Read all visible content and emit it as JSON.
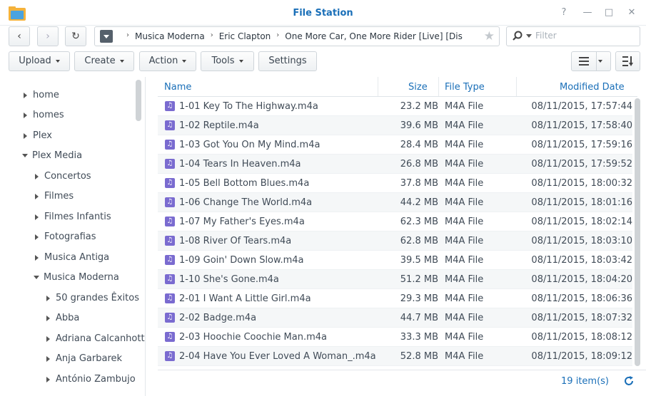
{
  "window": {
    "title": "File Station",
    "controls": {
      "help": "?",
      "minimize": "—",
      "maximize": "□",
      "close": "✕"
    }
  },
  "nav": {
    "back_icon": "‹",
    "forward_icon": "›",
    "refresh_icon": "↻"
  },
  "path": {
    "crumbs": [
      "Musica Moderna",
      "Eric Clapton",
      "One More Car, One More Rider [Live] [Dis"
    ],
    "separator": "›",
    "star_icon": "★"
  },
  "filter": {
    "placeholder": "Filter",
    "value": ""
  },
  "toolbar": {
    "upload": "Upload",
    "create": "Create",
    "action": "Action",
    "tools": "Tools",
    "settings": "Settings"
  },
  "tree": {
    "items": [
      {
        "label": "home",
        "state": "closed",
        "level": 0
      },
      {
        "label": "homes",
        "state": "closed",
        "level": 0
      },
      {
        "label": "Plex",
        "state": "closed",
        "level": 0
      },
      {
        "label": "Plex Media",
        "state": "open",
        "level": 0
      },
      {
        "label": "Concertos",
        "state": "closed",
        "level": 1
      },
      {
        "label": "Filmes",
        "state": "closed",
        "level": 1
      },
      {
        "label": "Filmes Infantis",
        "state": "closed",
        "level": 1
      },
      {
        "label": "Fotografias",
        "state": "closed",
        "level": 1
      },
      {
        "label": "Musica Antiga",
        "state": "closed",
        "level": 1
      },
      {
        "label": "Musica Moderna",
        "state": "open",
        "level": 1
      },
      {
        "label": "50 grandes Êxitos",
        "state": "closed",
        "level": 2
      },
      {
        "label": "Abba",
        "state": "closed",
        "level": 2
      },
      {
        "label": "Adriana Calcanhotto",
        "state": "closed",
        "level": 2
      },
      {
        "label": "Anja Garbarek",
        "state": "closed",
        "level": 2
      },
      {
        "label": "António Zambujo",
        "state": "closed",
        "level": 2
      }
    ]
  },
  "table": {
    "columns": {
      "name": "Name",
      "size": "Size",
      "type": "File Type",
      "modified": "Modified Date"
    },
    "rows": [
      {
        "name": "1-01 Key To The Highway.m4a",
        "size": "23.2 MB",
        "type": "M4A File",
        "modified": "08/11/2015, 17:57:44"
      },
      {
        "name": "1-02 Reptile.m4a",
        "size": "39.6 MB",
        "type": "M4A File",
        "modified": "08/11/2015, 17:58:40"
      },
      {
        "name": "1-03 Got You On My Mind.m4a",
        "size": "28.4 MB",
        "type": "M4A File",
        "modified": "08/11/2015, 17:59:16"
      },
      {
        "name": "1-04 Tears In Heaven.m4a",
        "size": "26.8 MB",
        "type": "M4A File",
        "modified": "08/11/2015, 17:59:52"
      },
      {
        "name": "1-05 Bell Bottom Blues.m4a",
        "size": "37.8 MB",
        "type": "M4A File",
        "modified": "08/11/2015, 18:00:32"
      },
      {
        "name": "1-06 Change The World.m4a",
        "size": "44.2 MB",
        "type": "M4A File",
        "modified": "08/11/2015, 18:01:16"
      },
      {
        "name": "1-07 My Father's Eyes.m4a",
        "size": "62.3 MB",
        "type": "M4A File",
        "modified": "08/11/2015, 18:02:14"
      },
      {
        "name": "1-08 River Of Tears.m4a",
        "size": "62.8 MB",
        "type": "M4A File",
        "modified": "08/11/2015, 18:03:10"
      },
      {
        "name": "1-09 Goin' Down Slow.m4a",
        "size": "39.5 MB",
        "type": "M4A File",
        "modified": "08/11/2015, 18:03:42"
      },
      {
        "name": "1-10 She's Gone.m4a",
        "size": "51.2 MB",
        "type": "M4A File",
        "modified": "08/11/2015, 18:04:20"
      },
      {
        "name": "2-01 I Want A Little Girl.m4a",
        "size": "29.3 MB",
        "type": "M4A File",
        "modified": "08/11/2015, 18:06:36"
      },
      {
        "name": "2-02 Badge.m4a",
        "size": "44.7 MB",
        "type": "M4A File",
        "modified": "08/11/2015, 18:07:32"
      },
      {
        "name": "2-03 Hoochie Coochie Man.m4a",
        "size": "33.3 MB",
        "type": "M4A File",
        "modified": "08/11/2015, 18:08:12"
      },
      {
        "name": "2-04 Have You Ever Loved A Woman_.m4a",
        "size": "52.8 MB",
        "type": "M4A File",
        "modified": "08/11/2015, 18:09:12"
      }
    ]
  },
  "status": {
    "item_count": "19 item(s)"
  },
  "colors": {
    "accent": "#1a6fb8",
    "music_icon": "#7a6bd0"
  }
}
